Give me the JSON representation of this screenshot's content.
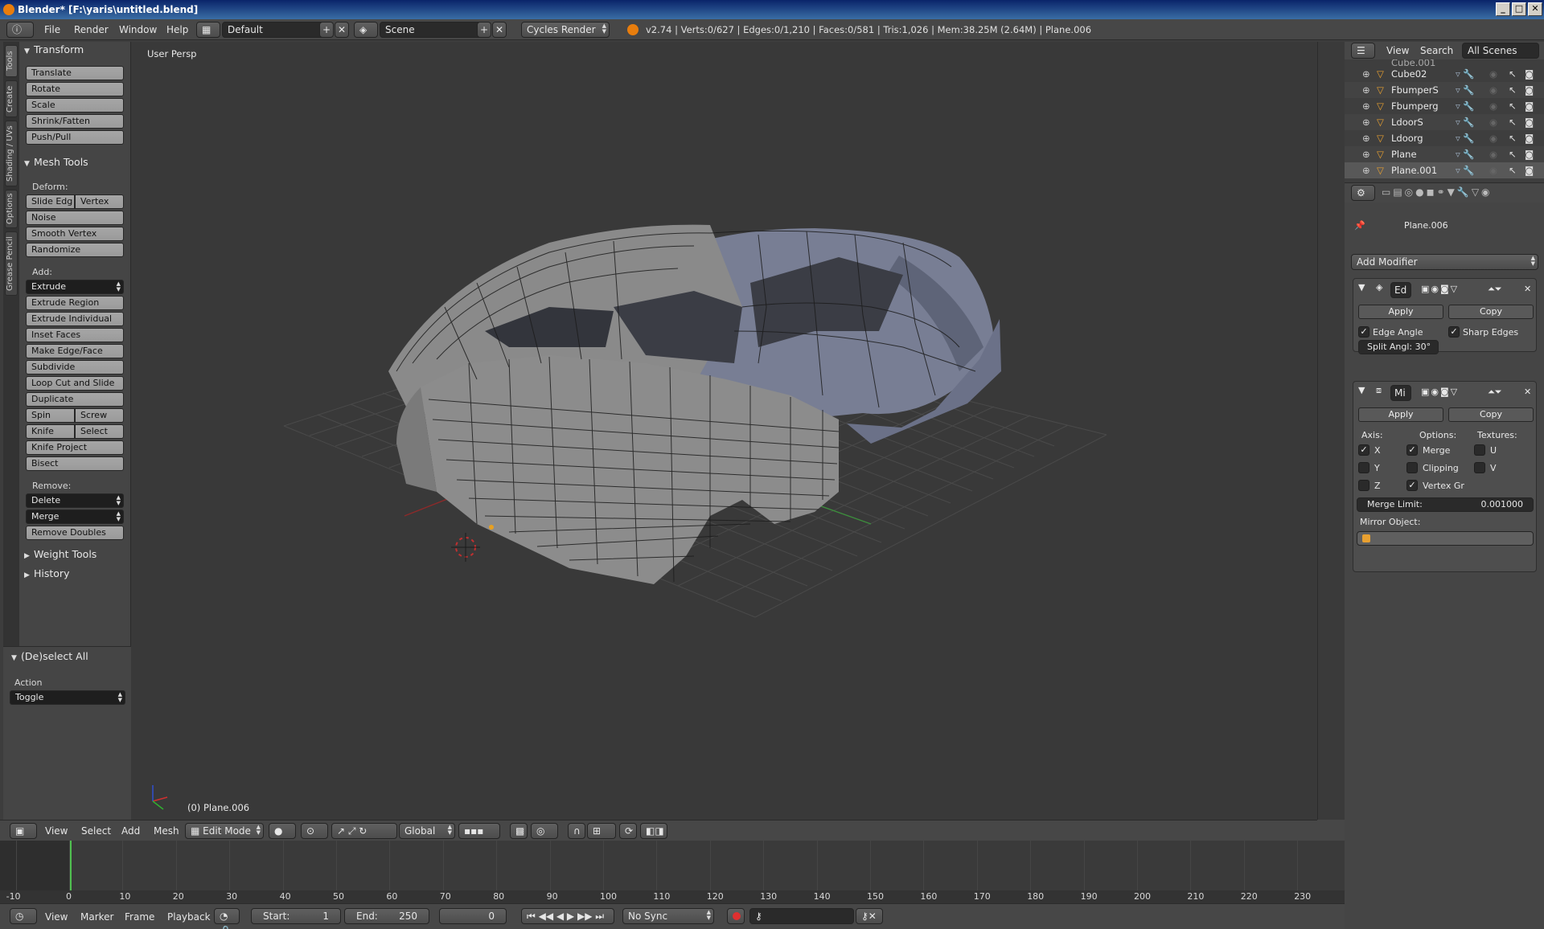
{
  "window": {
    "title": "Blender* [F:\\yaris\\untitled.blend]",
    "min": "_",
    "max": "□",
    "close": "✕"
  },
  "info": {
    "menus": [
      "File",
      "Render",
      "Window",
      "Help"
    ],
    "layout": "Default",
    "scene": "Scene",
    "engine": "Cycles Render",
    "stats": "v2.74 | Verts:0/627 | Edges:0/1,210 | Faces:0/581 | Tris:1,026 | Mem:38.25M (2.64M) | Plane.006"
  },
  "tabs": [
    "Tools",
    "Create",
    "Shading / UVs",
    "Options",
    "Grease Pencil"
  ],
  "tools": {
    "transform": {
      "title": "Transform",
      "buttons": [
        "Translate",
        "Rotate",
        "Scale",
        "Shrink/Fatten",
        "Push/Pull"
      ]
    },
    "mesh_tools": {
      "title": "Mesh Tools",
      "deform_label": "Deform:",
      "slide_edge": "Slide Edg",
      "vertex": "Vertex",
      "noise": "Noise",
      "smooth_vertex": "Smooth Vertex",
      "randomize": "Randomize",
      "add_label": "Add:",
      "extrude": "Extrude",
      "add_buttons": [
        "Extrude Region",
        "Extrude Individual",
        "Inset Faces",
        "Make Edge/Face",
        "Subdivide",
        "Loop Cut and Slide",
        "Duplicate"
      ],
      "spin": "Spin",
      "screw": "Screw",
      "knife": "Knife",
      "select": "Select",
      "knife_project": "Knife Project",
      "bisect": "Bisect",
      "remove_label": "Remove:",
      "delete": "Delete",
      "merge": "Merge",
      "remove_doubles": "Remove Doubles"
    },
    "weight_tools": "Weight Tools",
    "history": "History",
    "operator": {
      "title": "(De)select All",
      "action_label": "Action",
      "action_value": "Toggle"
    }
  },
  "viewport": {
    "view_name": "User Persp",
    "object_label": "(0) Plane.006"
  },
  "viewport_header": {
    "menus": [
      "View",
      "Select",
      "Add",
      "Mesh"
    ],
    "mode": "Edit Mode",
    "orientation": "Global"
  },
  "timeline": {
    "ticks": [
      "-10",
      "0",
      "10",
      "20",
      "30",
      "40",
      "50",
      "60",
      "70",
      "80",
      "90",
      "100",
      "110",
      "120",
      "130",
      "140",
      "150",
      "160",
      "170",
      "180",
      "190",
      "200",
      "210",
      "220",
      "230"
    ],
    "current_frame": "0",
    "menus": [
      "View",
      "Marker",
      "Frame",
      "Playback"
    ],
    "start_label": "Start:",
    "start": "1",
    "end_label": "End:",
    "end": "250",
    "frame": "0",
    "sync": "No Sync"
  },
  "outliner": {
    "menus": [
      "View",
      "Search"
    ],
    "filter": "All Scenes",
    "partial_top": "Cube.001",
    "items": [
      "Cube02",
      "FbumperS",
      "Fbumperg",
      "LdoorS",
      "Ldoorg",
      "Plane",
      "Plane.001"
    ]
  },
  "properties": {
    "object": "Plane.006",
    "add_modifier": "Add Modifier",
    "mod1": {
      "name": "Ed",
      "apply": "Apply",
      "copy": "Copy",
      "edge_angle": "Edge Angle",
      "sharp_edges": "Sharp Edges",
      "split_angle": "Split Angl: 30°"
    },
    "mod2": {
      "name": "Mi",
      "apply": "Apply",
      "copy": "Copy",
      "axis_label": "Axis:",
      "options_label": "Options:",
      "textures_label": "Textures:",
      "x": "X",
      "y": "Y",
      "z": "Z",
      "merge": "Merge",
      "clipping": "Clipping",
      "vertex_gr": "Vertex Gr",
      "u": "U",
      "v": "V",
      "merge_limit_label": "Merge Limit:",
      "merge_limit": "0.001000",
      "mirror_object_label": "Mirror Object:"
    }
  }
}
